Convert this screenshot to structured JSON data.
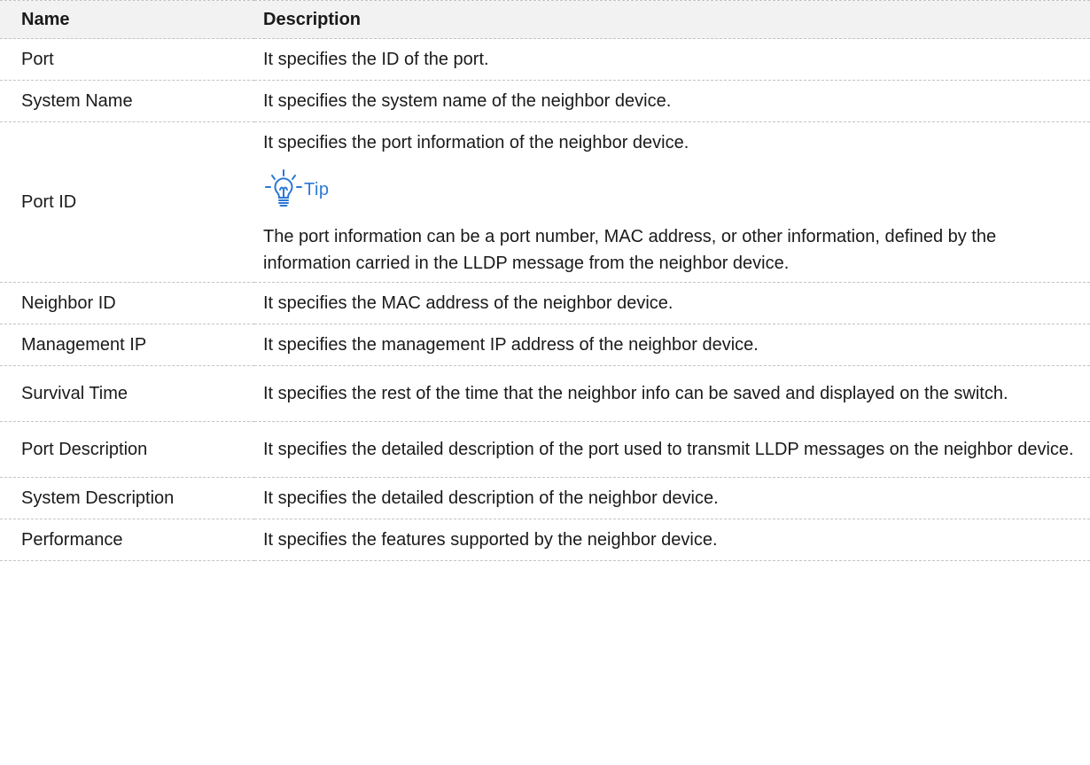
{
  "table": {
    "headers": {
      "name": "Name",
      "description": "Description"
    },
    "rows": [
      {
        "name": "Port",
        "description": "It specifies the ID of the port."
      },
      {
        "name": "System Name",
        "description": "It specifies the system name of the neighbor device."
      },
      {
        "name": "Port ID",
        "description": "It specifies the port information of the neighbor device.",
        "tip": {
          "label": "Tip",
          "icon": "lightbulb-icon",
          "text": "The port information can be a port number, MAC address, or other information, defined by the information carried in the LLDP message from the neighbor device."
        }
      },
      {
        "name": "Neighbor ID",
        "description": "It specifies the MAC address of the neighbor device."
      },
      {
        "name": "Management IP",
        "description": "It specifies the management IP address of the neighbor device."
      },
      {
        "name": "Survival Time",
        "description": "It specifies the rest of the time that the neighbor info can be saved and displayed on the switch."
      },
      {
        "name": "Port Description",
        "description": "It specifies the detailed description of the port used to transmit LLDP messages on the neighbor device."
      },
      {
        "name": "System Description",
        "description": "It specifies the detailed description of the neighbor device."
      },
      {
        "name": "Performance",
        "description": "It specifies the features supported by the neighbor device."
      }
    ]
  },
  "colors": {
    "header_bg": "#f2f2f2",
    "tip_accent": "#2b78d4",
    "divider": "#c4c4c4"
  }
}
